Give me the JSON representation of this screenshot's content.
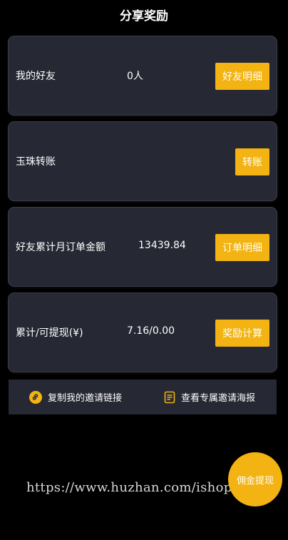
{
  "header": {
    "title": "分享奖励"
  },
  "cards": [
    {
      "label": "我的好友",
      "value": "0人",
      "button": "好友明细"
    },
    {
      "label": "玉珠转账",
      "value": "",
      "button": "转账"
    },
    {
      "label": "好友累计月订单金额",
      "value": "13439.84",
      "button": "订单明细"
    },
    {
      "label": "累计/可提现(¥)",
      "value": "7.16/0.00",
      "button": "奖励计算"
    }
  ],
  "links": {
    "copy_invite": "复制我的邀请链接",
    "view_poster": "查看专属邀请海报"
  },
  "fab": {
    "label": "佣金提现"
  },
  "watermark": "https://www.huzhan.com/ishop2/512",
  "colors": {
    "accent": "#f2b313",
    "card_bg": "#262833",
    "page_bg": "#000000"
  }
}
